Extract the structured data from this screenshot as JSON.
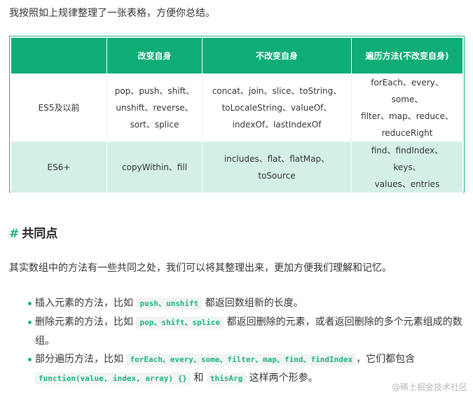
{
  "intro": "我按照如上规律整理了一张表格，方便你总结。",
  "table": {
    "headers": [
      "",
      "改变自身",
      "不改变自身",
      "遍历方法(不改变自身)"
    ],
    "rows": [
      {
        "label": "ES5及以前",
        "mutating": [
          "pop、push、shift、",
          "unshift、reverse、",
          "sort、splice"
        ],
        "non_mutating": [
          "concat、join、slice、toString、",
          "toLocaleString、valueOf、",
          "indexOf、lastIndexOf"
        ],
        "iteration": [
          "forEach、every、some、",
          "filter、map、reduce、",
          "reduceRight"
        ]
      },
      {
        "label": "ES6+",
        "mutating": [
          "copyWithin、fill"
        ],
        "non_mutating": [
          "includes、flat、flatMap、",
          "toSource"
        ],
        "iteration": [
          "find、findIndex、keys、",
          "values、entries"
        ]
      }
    ]
  },
  "section": {
    "hash": "#",
    "title": "共同点",
    "paragraph": "其实数组中的方法有一些共同之处，我们可以将其整理出来，更加方便我们理解和记忆。",
    "points": [
      {
        "pre": "插入元素的方法，比如",
        "code": "push、unshift",
        "post": "都返回数组新的长度。"
      },
      {
        "pre": "删除元素的方法，比如",
        "code": "pop、shift、splice",
        "post": "都返回删除的元素，或者返回删除的多个元素组成的数组。"
      },
      {
        "pre": "部分遍历方法，比如",
        "code": "forEach、every、some、filter、map、find、findIndex",
        "mid": "，它们都包含",
        "code2": "function(value, index, array) {}",
        "and": "和",
        "code3": "thisArg",
        "post": "这样两个形参。"
      }
    ]
  },
  "watermark": "@稀土掘金技术社区"
}
